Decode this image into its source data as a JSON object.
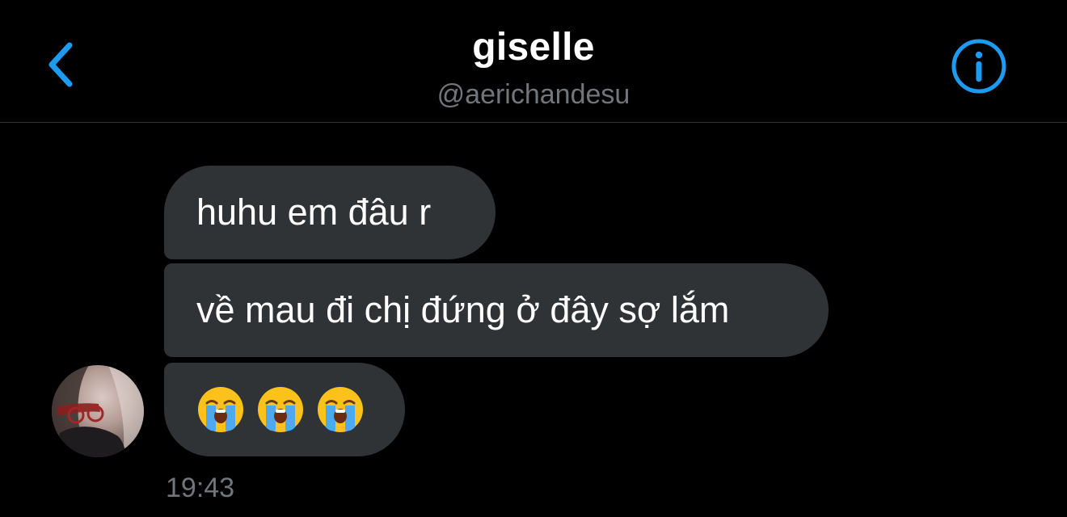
{
  "header": {
    "title": "giselle",
    "handle": "@aerichandesu",
    "back_icon": "chevron-left-icon",
    "info_icon": "info-icon",
    "accent_color": "#1d9bf0"
  },
  "messages": [
    {
      "text": "huhu em đâu r"
    },
    {
      "text": "về mau đi chị đứng ở đây sợ lắm"
    },
    {
      "emojis": [
        "loudly-crying-face-icon",
        "loudly-crying-face-icon",
        "loudly-crying-face-icon"
      ]
    }
  ],
  "timestamp": "19:43",
  "colors": {
    "background": "#000000",
    "bubble": "#2f3336",
    "secondary_text": "#71767b"
  }
}
